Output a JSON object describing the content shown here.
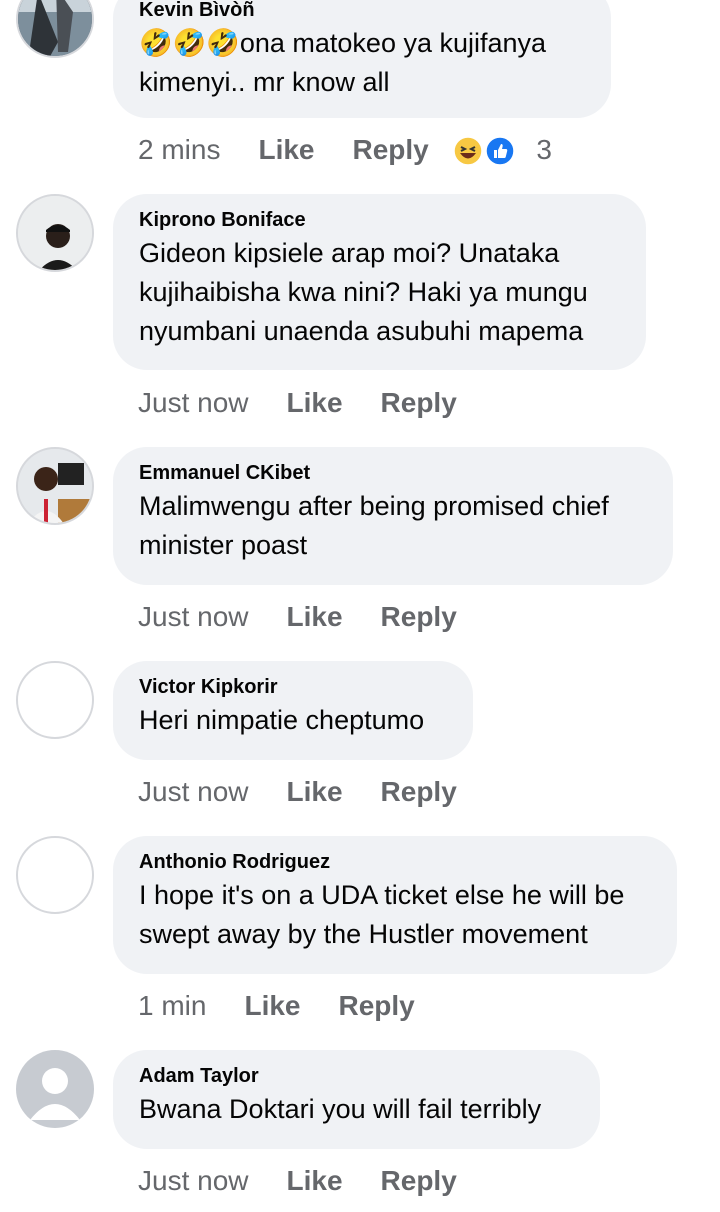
{
  "comments": [
    {
      "author": "Kevin Bìvòñ",
      "text_prefix_emoji": "🤣🤣🤣",
      "text": "ona matokeo ya kujifanya kimenyi.. mr know all",
      "time": "2 mins",
      "like_label": "Like",
      "reply_label": "Reply",
      "reaction_icons": [
        "haha-icon",
        "like-icon"
      ],
      "reaction_count": "3"
    },
    {
      "author": "Kiprono Boniface",
      "text": "Gideon kipsiele arap moi? Unataka kujihaibisha kwa nini? Haki ya mungu nyumbani unaenda asubuhi mapema",
      "time": "Just now",
      "like_label": "Like",
      "reply_label": "Reply"
    },
    {
      "author": "Emmanuel CKibet",
      "text": "Malimwengu after being promised chief minister poast",
      "time": "Just now",
      "like_label": "Like",
      "reply_label": "Reply"
    },
    {
      "author": "Victor Kipkorir",
      "text": "Heri nimpatie cheptumo",
      "time": "Just now",
      "like_label": "Like",
      "reply_label": "Reply"
    },
    {
      "author": "Anthonio Rodriguez",
      "text": "I hope it's on a UDA ticket else he will be swept away by the Hustler movement",
      "time": "1 min",
      "like_label": "Like",
      "reply_label": "Reply"
    },
    {
      "author": "Adam Taylor",
      "text": "Bwana Doktari you will fail terribly",
      "time": "Just now",
      "like_label": "Like",
      "reply_label": "Reply"
    }
  ],
  "colors": {
    "bubble": "#f0f2f5",
    "meta_text": "#65676b",
    "like_blue": "#1877f2",
    "haha_yellow": "#f7c843"
  }
}
